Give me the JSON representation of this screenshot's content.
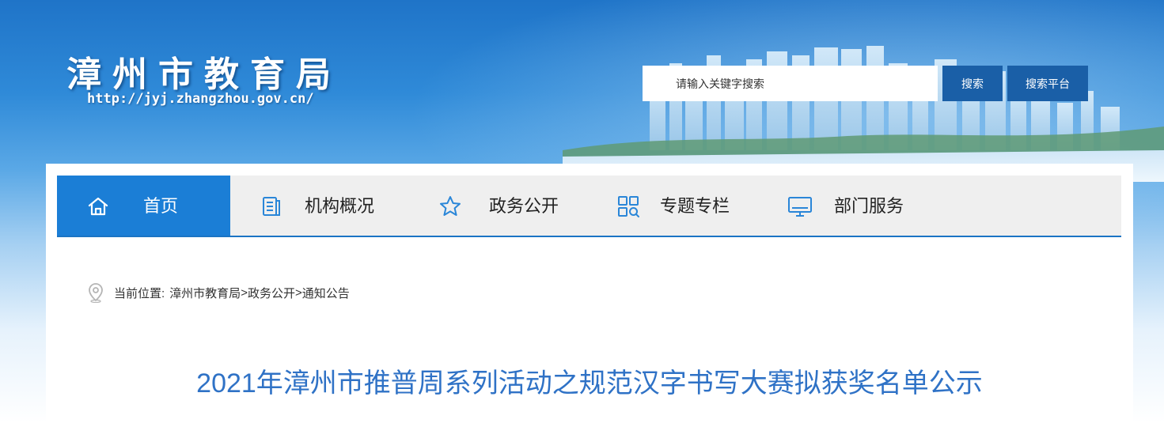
{
  "header": {
    "title": "漳州市教育局",
    "url": "http://jyj.zhangzhou.gov.cn/"
  },
  "search": {
    "placeholder": "请输入关键字搜索",
    "search_label": "搜索",
    "platform_label": "搜索平台"
  },
  "nav": {
    "items": [
      {
        "label": "首页",
        "icon": "home-icon"
      },
      {
        "label": "机构概况",
        "icon": "document-list-icon"
      },
      {
        "label": "政务公开",
        "icon": "star-icon"
      },
      {
        "label": "专题专栏",
        "icon": "grid-search-icon"
      },
      {
        "label": "部门服务",
        "icon": "monitor-icon"
      }
    ]
  },
  "breadcrumb": {
    "prefix": "当前位置:",
    "items": [
      "漳州市教育局",
      "政务公开",
      "通知公告"
    ],
    "separator": ">"
  },
  "article": {
    "title": "2021年漳州市推普周系列活动之规范汉字书写大赛拟获奖名单公示"
  },
  "colors": {
    "brand_blue": "#1b7ed6",
    "button_blue": "#1a5fa7",
    "title_blue": "#2f72c6",
    "nav_bg": "#efefef"
  }
}
